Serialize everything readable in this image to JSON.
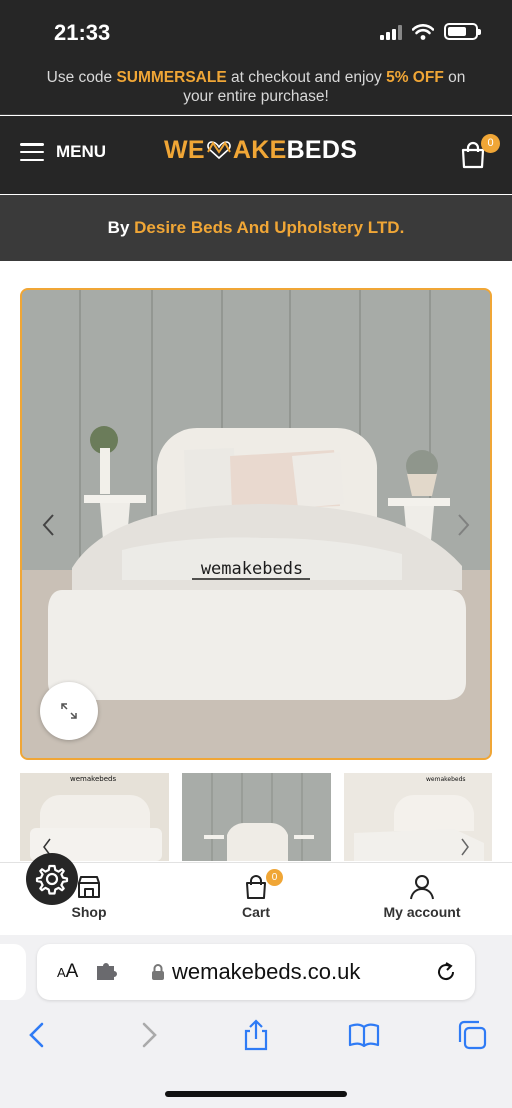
{
  "status": {
    "time": "21:33"
  },
  "promo": {
    "prefix": "Use code ",
    "code": "SUMMERSALE",
    "middle": " at checkout and enjoy ",
    "discount": "5% OFF",
    "suffix": " on your entire purchase!"
  },
  "header": {
    "menu_label": "MENU",
    "logo_part1": "WE",
    "logo_part2": "AKE",
    "logo_part3": "BEDS",
    "cart_count": "0"
  },
  "vendor": {
    "prefix": "By ",
    "name": "Desire Beds And Upholstery LTD."
  },
  "gallery": {
    "watermark": "wemakebeds",
    "thumb_watermark": "wemakebeds"
  },
  "bottom_nav": {
    "shop_label": "Shop",
    "cart_label": "Cart",
    "cart_count": "0",
    "account_label": "My account"
  },
  "browser": {
    "aa_small": "A",
    "aa_large": "A",
    "url": "wemakebeds.co.uk"
  },
  "colors": {
    "accent": "#f0a636",
    "header_bg": "#262626",
    "vendor_bg": "#3a3a3a",
    "browser_blue": "#2f7bf5"
  },
  "icons": [
    "hamburger-icon",
    "cart-icon",
    "chevron-left-icon",
    "chevron-right-icon",
    "expand-icon",
    "gear-icon",
    "shop-icon",
    "account-icon",
    "puzzle-icon",
    "lock-icon",
    "reload-icon",
    "back-icon",
    "forward-icon",
    "share-icon",
    "bookmarks-icon",
    "tabs-icon"
  ]
}
